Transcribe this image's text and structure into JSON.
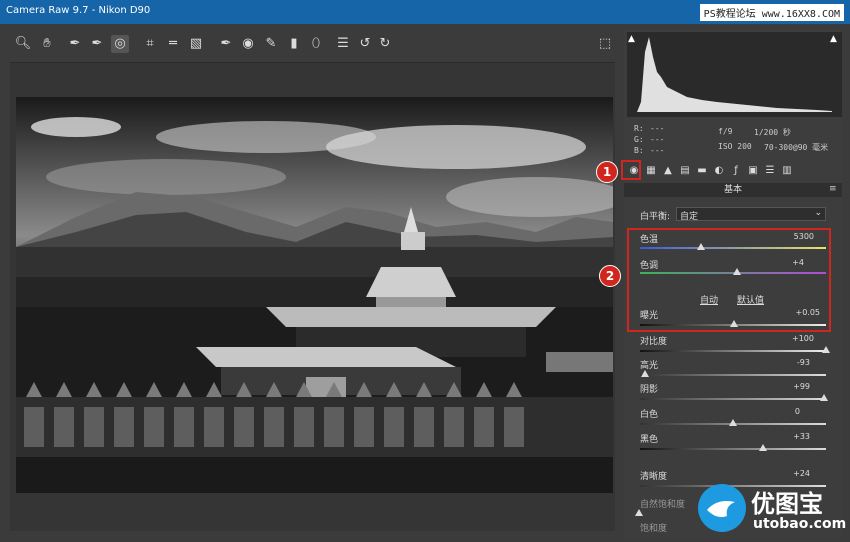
{
  "window": {
    "title": "Camera Raw 9.7 -  Nikon D90",
    "watermark": "PS教程论坛 www.16XX8.COM"
  },
  "toolbar": {
    "icons": [
      "zoom-icon",
      "hand-icon",
      "white-balance-icon",
      "color-sampler-icon",
      "targeted-adjust-icon",
      "crop-icon",
      "straighten-icon",
      "transform-icon",
      "spot-removal-icon",
      "red-eye-icon",
      "adjustment-brush-icon",
      "graduated-filter-icon",
      "radial-filter-icon",
      "preferences-icon",
      "rotate-ccw-icon",
      "rotate-cw-icon",
      "fullscreen-icon"
    ]
  },
  "info": {
    "r_label": "R:",
    "g_label": "G:",
    "b_label": "B:",
    "dash": "---",
    "aperture": "f/9",
    "shutter": "1/200 秒",
    "iso": "ISO 200",
    "lens": "70-300@90 毫米"
  },
  "panel": {
    "title": "基本",
    "wb_label": "白平衡:",
    "wb_value": "自定",
    "auto": "自动",
    "default": "默认值"
  },
  "sliders": [
    {
      "label": "色温",
      "value": "5300",
      "pos": 0.35
    },
    {
      "label": "色调",
      "value": "+4",
      "pos": 0.52
    },
    {
      "label": "曝光",
      "value": "+0.05",
      "pos": 0.51
    },
    {
      "label": "对比度",
      "value": "+100",
      "pos": 1.0
    },
    {
      "label": "高光",
      "value": "-93",
      "pos": 0.03
    },
    {
      "label": "阴影",
      "value": "+99",
      "pos": 0.99
    },
    {
      "label": "白色",
      "value": "0",
      "pos": 0.5
    },
    {
      "label": "黑色",
      "value": "+33",
      "pos": 0.66
    },
    {
      "label": "清晰度",
      "value": "+24",
      "pos": 0.6
    },
    {
      "label": "自然饱和度",
      "value": "",
      "pos": 0.0
    },
    {
      "label": "饱和度",
      "value": "",
      "pos": 0.0
    }
  ],
  "callouts": [
    "1",
    "2"
  ],
  "logo": {
    "cn": "优图宝",
    "en": "utobao.com"
  }
}
